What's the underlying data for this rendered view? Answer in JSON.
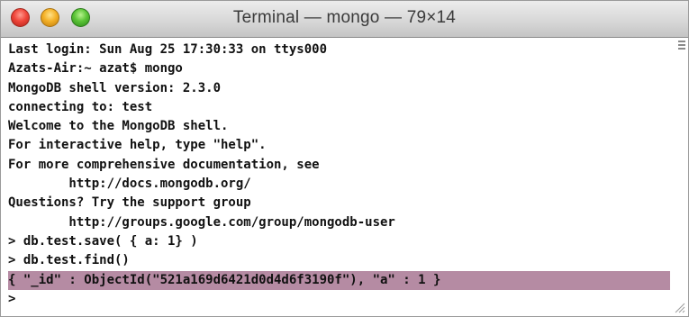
{
  "window": {
    "title": "Terminal — mongo — 79×14"
  },
  "icons": {
    "close": "close-button-icon",
    "minimize": "minimize-button-icon",
    "zoom": "zoom-button-icon",
    "scroll": "scroll-indicator-icon",
    "resize": "resize-grip-icon"
  },
  "colors": {
    "selection": "#b58ba3",
    "text": "#111111",
    "background": "#ffffff"
  },
  "terminal": {
    "lines": [
      "Last login: Sun Aug 25 17:30:33 on ttys000",
      "Azats-Air:~ azat$ mongo",
      "MongoDB shell version: 2.3.0",
      "connecting to: test",
      "Welcome to the MongoDB shell.",
      "For interactive help, type \"help\".",
      "For more comprehensive documentation, see",
      "        http://docs.mongodb.org/",
      "Questions? Try the support group",
      "        http://groups.google.com/group/mongodb-user",
      "> db.test.save( { a: 1} )",
      "> db.test.find()",
      "{ \"_id\" : ObjectId(\"521a169d6421d0d4d6f3190f\"), \"a\" : 1 }",
      ">"
    ]
  }
}
